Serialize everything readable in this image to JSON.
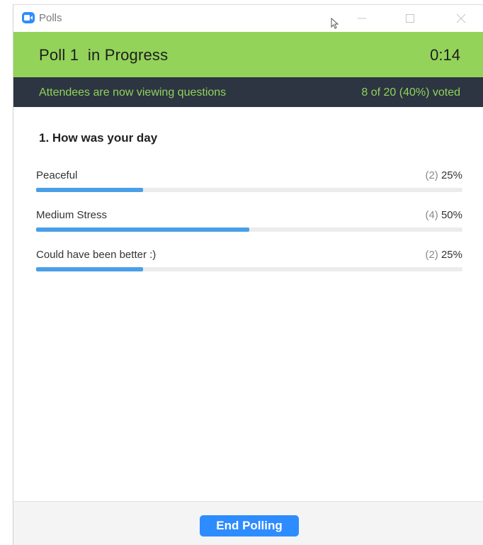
{
  "window": {
    "title": "Polls",
    "app_icon": "zoom-camera-icon",
    "controls": [
      "minimize-icon",
      "maximize-icon",
      "close-icon"
    ]
  },
  "header": {
    "poll_title": "Poll 1  in Progress",
    "timer": "0:14",
    "background_color": "#93d35a"
  },
  "status": {
    "message": "Attendees are now viewing questions",
    "votes": "8 of 20 (40%) voted",
    "background_color": "#2c3541",
    "text_color": "#8fd35c"
  },
  "question": {
    "text": "1. How was your day",
    "answers": [
      {
        "label": "Peaceful",
        "count": "(2)",
        "percent": "25%",
        "fraction": 0.25
      },
      {
        "label": "Medium Stress",
        "count": "(4)",
        "percent": "50%",
        "fraction": 0.5
      },
      {
        "label": "Could have been better :)",
        "count": "(2)",
        "percent": "25%",
        "fraction": 0.25
      }
    ]
  },
  "footer": {
    "end_button_label": "End Polling"
  },
  "colors": {
    "accent": "#2d8cff",
    "bar_fill": "#4a9fe8"
  }
}
